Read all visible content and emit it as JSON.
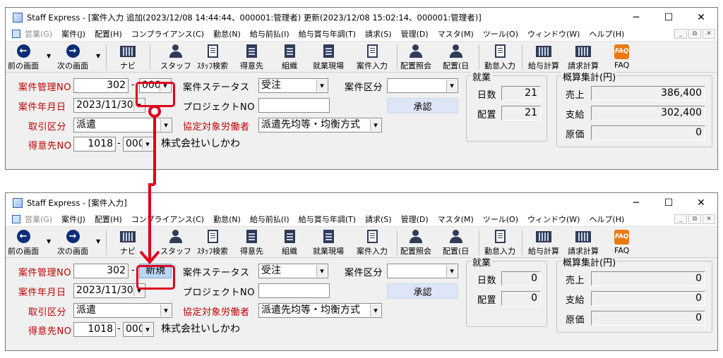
{
  "menu_items": [
    "営業(G)",
    "案件(J)",
    "配置(H)",
    "コンプライアンス(C)",
    "勤怠(N)",
    "給与前払(I)",
    "給与賞与年調(T)",
    "請求(S)",
    "管理(D)",
    "マスタ(M)",
    "ツール(O)",
    "ウィンドウ(W)",
    "ヘルプ(H)"
  ],
  "toolbar": {
    "prev": "前の画面",
    "next": "次の画面",
    "navi": "ナビ",
    "staff": "スタッフ",
    "staff_search": "ｽﾀｯﾌ検索",
    "client": "得意先",
    "org": "組織",
    "site": "就業現場",
    "case_entry": "案件入力",
    "placement_inquiry": "配置照会",
    "placement_day": "配置(日",
    "attendance_entry": "勤怠入力",
    "payroll_calc": "給与計算",
    "billing_calc": "請求計算",
    "faq": "FAQ"
  },
  "icons": {
    "prev": "arrow-left-icon",
    "next": "arrow-right-icon",
    "navi": "keyboard-icon",
    "staff": "staff-icon",
    "staff_search": "document-search-icon",
    "client": "building-icon",
    "org": "building-icon",
    "site": "building-icon",
    "case_entry": "entry-icon",
    "placement_inquiry": "people-icon",
    "placement_day": "people-icon",
    "attendance_entry": "pen-document-icon",
    "payroll_calc": "calculator-icon",
    "billing_calc": "calculator-icon",
    "faq": "faq-icon"
  },
  "labels": {
    "case_no": "案件管理NO",
    "case_status": "案件ステータス",
    "case_type": "案件区分",
    "case_date": "案件年月日",
    "project_no": "プロジェクトNO",
    "approve": "承認",
    "trade_type": "取引区分",
    "agreement_worker": "協定対象労働者",
    "client_no": "得意先NO",
    "shugyo": "就業",
    "days": "日数",
    "placement": "配置",
    "summary": "概算集計(円)",
    "sales": "売上",
    "payment": "支給",
    "cost": "原価",
    "dash": "-"
  },
  "window1": {
    "title": "Staff Express - [案件入力 追加(2023/12/08 14:44:44、000001:管理者) 更新(2023/12/08 15:02:14、000001:管理者)]",
    "case_no": "302",
    "case_branch": "000",
    "status": "受注",
    "case_type": "",
    "case_date": "2023/11/30",
    "project_no": "",
    "trade_type": "派遣",
    "agreement_worker": "派遣先均等・均衡方式",
    "client_no": "1018",
    "client_branch": "000",
    "client_name": "株式会社いしかわ",
    "days": "21",
    "placement": "21",
    "sales": "386,400",
    "payment": "302,400",
    "cost": "0"
  },
  "window2": {
    "title": "Staff Express - [案件入力]",
    "case_no": "302",
    "case_branch": "新規",
    "status": "受注",
    "case_type": "",
    "case_date": "2023/11/30",
    "project_no": "",
    "trade_type": "派遣",
    "agreement_worker": "派遣先均等・均衡方式",
    "client_no": "1018",
    "client_branch": "000",
    "client_name": "株式会社いしかわ",
    "days": "0",
    "placement": "0",
    "sales": "0",
    "payment": "0",
    "cost": "0"
  },
  "colors": {
    "label_red": "#c00000",
    "highlight_red": "#e0001e",
    "new_bg": "#b9d6f2",
    "approve_bg": "#dde5f7"
  }
}
